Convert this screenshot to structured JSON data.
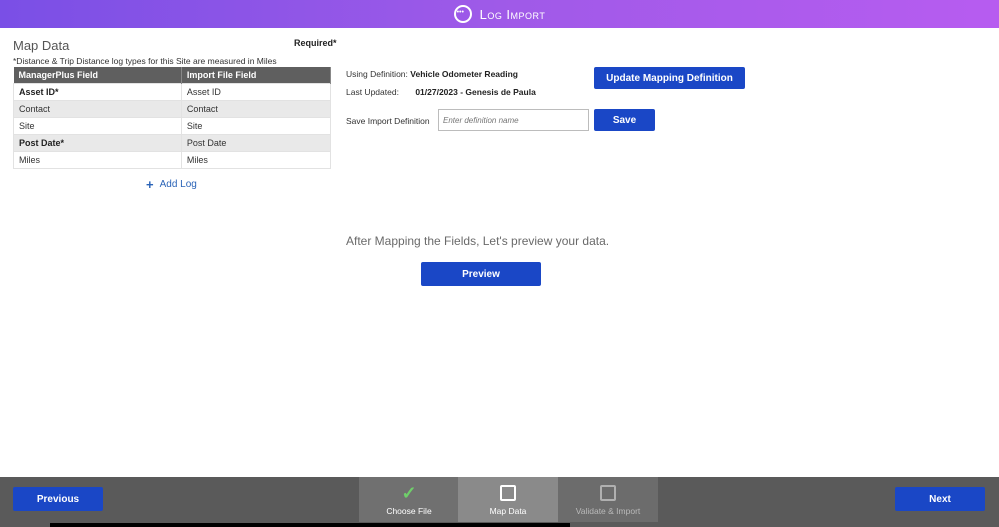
{
  "header": {
    "title": "Log Import",
    "icon": "messages-icon"
  },
  "map": {
    "title": "Map Data",
    "required": "Required*",
    "note": "*Distance & Trip Distance log types for this Site are measured in Miles",
    "columns": [
      "ManagerPlus Field",
      "Import File Field"
    ],
    "rows": [
      [
        "Asset ID*",
        "Asset ID"
      ],
      [
        "Contact",
        "Contact"
      ],
      [
        "Site",
        "Site"
      ],
      [
        "Post Date*",
        "Post Date"
      ],
      [
        "Miles",
        "Miles"
      ]
    ],
    "add_log": "Add Log"
  },
  "definition": {
    "using_label": "Using Definition:",
    "using_value": "Vehicle Odometer Reading",
    "updated_label": "Last Updated:",
    "updated_value": "01/27/2023 - Genesis de Paula",
    "save_label": "Save Import Definition",
    "input_placeholder": "Enter definition name",
    "update_button": "Update Mapping Definition",
    "save_button": "Save"
  },
  "preview": {
    "message": "After Mapping the Fields, Let's preview your data.",
    "button": "Preview"
  },
  "footer": {
    "previous": "Previous",
    "next": "Next",
    "steps": [
      {
        "label": "Choose File",
        "state": "complete"
      },
      {
        "label": "Map Data",
        "state": "active"
      },
      {
        "label": "Validate & Import",
        "state": "disabled"
      }
    ]
  },
  "colors": {
    "accent": "#1a47c6",
    "header_start": "#7a4fe6",
    "header_end": "#b75cf0",
    "footer": "#5a5a5a"
  }
}
